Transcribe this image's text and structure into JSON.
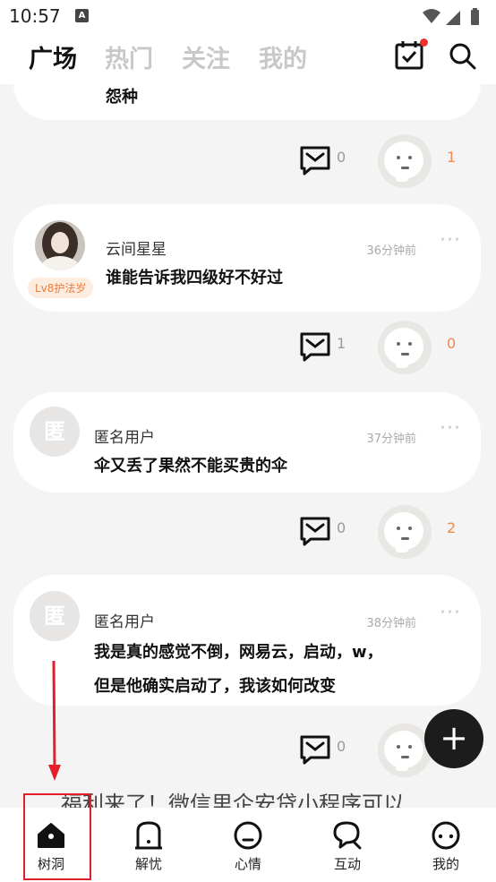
{
  "status_bar": {
    "time": "10:57",
    "notif_icon": "A"
  },
  "header": {
    "tabs": [
      {
        "label": "广场",
        "active": true
      },
      {
        "label": "热门",
        "active": false
      },
      {
        "label": "关注",
        "active": false
      },
      {
        "label": "我的",
        "active": false
      }
    ]
  },
  "posts": [
    {
      "partial_text": "怨种",
      "comments": "0",
      "likes": "1"
    },
    {
      "username": "云间星星",
      "time": "36分钟前",
      "level": "Lv8护法岁",
      "text": "谁能告诉我四级好不好过",
      "comments": "1",
      "likes": "0"
    },
    {
      "username": "匿名用户",
      "avatar_char": "匿",
      "time": "37分钟前",
      "text": "伞又丢了果然不能买贵的伞",
      "comments": "0",
      "likes": "2"
    },
    {
      "username": "匿名用户",
      "avatar_char": "匿",
      "time": "38分钟前",
      "text_line1": "我是真的感觉不倒，网易云，启动，w，",
      "text_line2": "但是他确实启动了，我该如何改变",
      "comments": "0"
    }
  ],
  "more_label": "···",
  "fab_label": "+",
  "promo_text": "福利来了！微信里企安贷小程序可以",
  "bottom_nav": [
    {
      "label": "树洞",
      "icon": "tree-hole-icon",
      "active": true
    },
    {
      "label": "解忧",
      "icon": "door-icon"
    },
    {
      "label": "心情",
      "icon": "mood-icon"
    },
    {
      "label": "互动",
      "icon": "chat-bubbles-icon"
    },
    {
      "label": "我的",
      "icon": "profile-icon"
    }
  ],
  "colors": {
    "accent_orange": "#ef8a4a",
    "annotation_red": "#e41e2b",
    "fab_dark": "#1c1c1c"
  }
}
